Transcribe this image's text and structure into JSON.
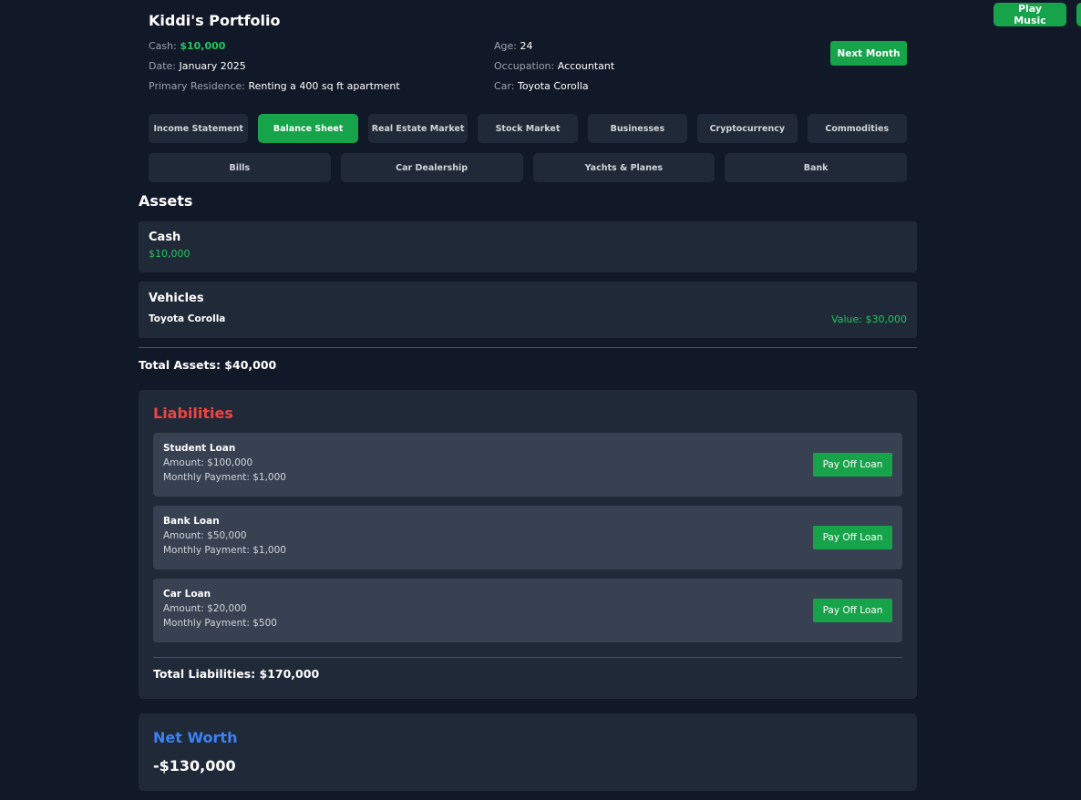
{
  "top_buttons": {
    "play_music": "Play Music"
  },
  "header": {
    "title": "Kiddi's Portfolio",
    "cash_label": "Cash:",
    "cash_value": "$10,000",
    "date_label": "Date:",
    "date_value": "January 2025",
    "residence_label": "Primary Residence:",
    "residence_value": "Renting a 400 sq ft apartment",
    "age_label": "Age:",
    "age_value": "24",
    "occupation_label": "Occupation:",
    "occupation_value": "Accountant",
    "car_label": "Car:",
    "car_value": "Toyota Corolla",
    "next_month": "Next Month"
  },
  "tabs_row1": [
    "Income Statement",
    "Balance Sheet",
    "Real Estate Market",
    "Stock Market",
    "Businesses",
    "Cryptocurrency",
    "Commodities"
  ],
  "tabs_row2": [
    "Bills",
    "Car Dealership",
    "Yachts & Planes",
    "Bank"
  ],
  "active_tab": "Balance Sheet",
  "assets": {
    "title": "Assets",
    "cash": {
      "title": "Cash",
      "value": "$10,000"
    },
    "vehicles": {
      "title": "Vehicles",
      "name": "Toyota Corolla",
      "value": "Value: $30,000"
    },
    "total": "Total Assets: $40,000"
  },
  "liabilities": {
    "title": "Liabilities",
    "loans": [
      {
        "name": "Student Loan",
        "amount": "Amount: $100,000",
        "payment": "Monthly Payment: $1,000",
        "button": "Pay Off Loan"
      },
      {
        "name": "Bank Loan",
        "amount": "Amount: $50,000",
        "payment": "Monthly Payment: $1,000",
        "button": "Pay Off Loan"
      },
      {
        "name": "Car Loan",
        "amount": "Amount: $20,000",
        "payment": "Monthly Payment: $500",
        "button": "Pay Off Loan"
      }
    ],
    "total": "Total Liabilities: $170,000"
  },
  "net_worth": {
    "title": "Net Worth",
    "value": "-$130,000"
  },
  "colors": {
    "accent_green": "#16a34a",
    "liability_red": "#ef4444",
    "net_worth_blue": "#3b82f6",
    "background": "#111827",
    "card": "#1f2937"
  }
}
